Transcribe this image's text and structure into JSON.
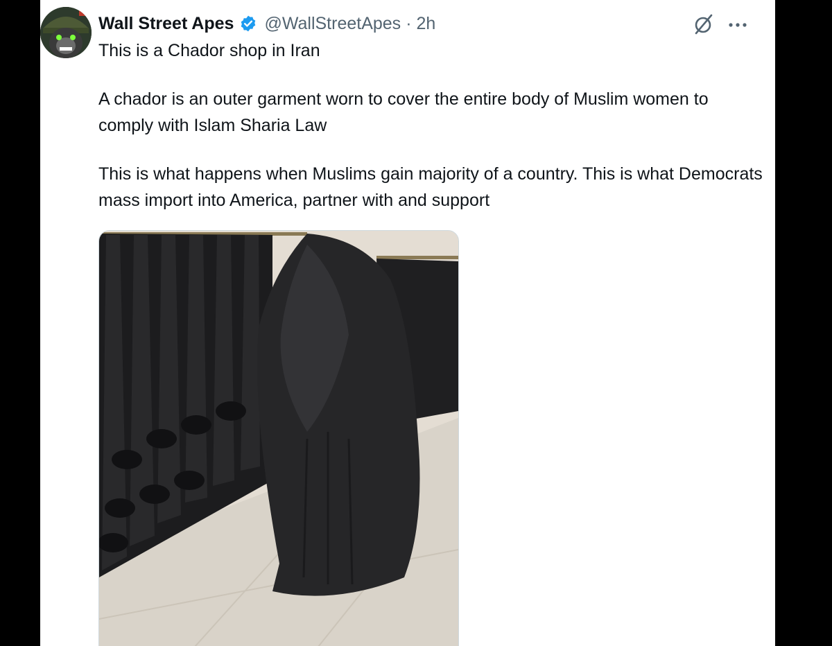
{
  "tweet": {
    "author_name": "Wall Street Apes",
    "handle": "@WallStreetApes",
    "separator": "·",
    "time": "2h",
    "text_paragraphs": [
      "This is a Chador shop in Iran",
      "A chador is an outer garment worn to cover the entire body of Muslim women to comply with Islam Sharia Law",
      "This is what happens when Muslims gain majority of a country. This is what Democrats mass import into America, partner with and support"
    ]
  },
  "icons": {
    "verified": "verified-badge-icon",
    "grok": "grok-icon",
    "more": "more-options-icon"
  },
  "colors": {
    "verified_blue": "#1d9bf0",
    "text_primary": "#0f1419",
    "text_secondary": "#536471"
  }
}
